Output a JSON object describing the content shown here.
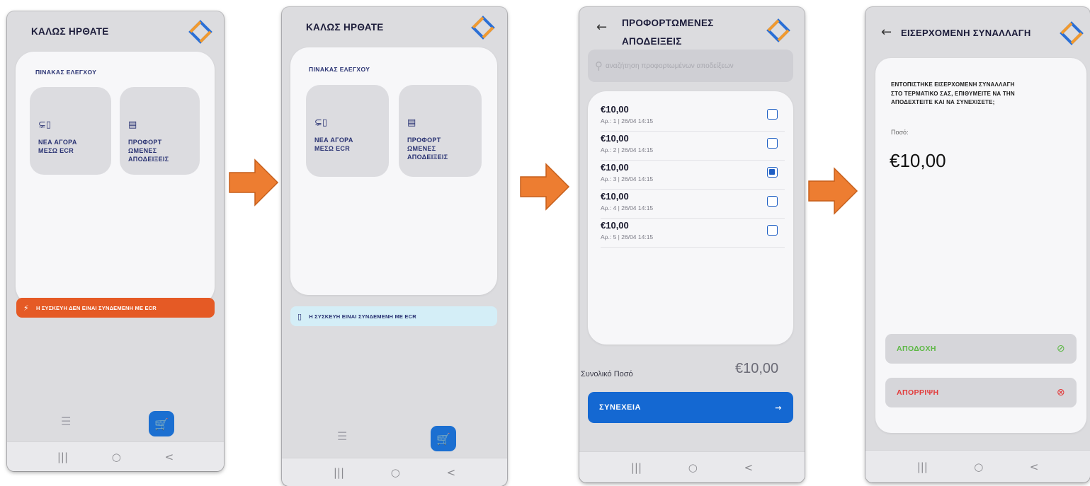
{
  "colors": {
    "navy": "#2a3373",
    "disconnected_bg": "#e55a25",
    "connected_bg": "#d4eef7",
    "primary": "#1468d2",
    "accept": "#5db845",
    "reject": "#e23b3b",
    "arrow": "#ed7d31"
  },
  "screen1": {
    "title": "ΚΑΛΩΣ ΗΡΘΑΤΕ",
    "dashboard_title": "ΠΙΝΑΚΑΣ ΕΛΕΓΧΟΥ",
    "tile1": {
      "icon": "ecr-device-icon",
      "glyph": "⊊▯",
      "label_l1": "ΝΕΑ ΑΓΟΡΑ",
      "label_l2": "ΜΕΣΩ ECR"
    },
    "tile2": {
      "icon": "receipt-icon",
      "glyph": "▤",
      "label_l1": "ΠΡΟΦΟΡΤ",
      "label_l2": "ΩΜΕΝΕΣ",
      "label_l3": "ΑΠΟΔΕΙΞΕΙΣ"
    },
    "status": {
      "icon": "disconnected-icon",
      "glyph": "⚡",
      "text": "Η ΣΥΣΚΕΥΗ ΔΕΝ ΕΙΝΑΙ ΣΥΝΔΕΜΕΝΗ ΜΕ ECR"
    },
    "list_glyph": "☰",
    "cart_glyph": "🛒"
  },
  "screen2": {
    "title": "ΚΑΛΩΣ ΗΡΘΑΤΕ",
    "dashboard_title": "ΠΙΝΑΚΑΣ ΕΛΕΓΧΟΥ",
    "tile1": {
      "glyph": "⊊▯",
      "label_l1": "ΝΕΑ ΑΓΟΡΑ",
      "label_l2": "ΜΕΣΩ ECR"
    },
    "tile2": {
      "glyph": "▤",
      "label_l1": "ΠΡΟΦΟΡΤ",
      "label_l2": "ΩΜΕΝΕΣ",
      "label_l3": "ΑΠΟΔΕΙΞΕΙΣ"
    },
    "status": {
      "icon": "connected-icon",
      "glyph": "▯",
      "text": "Η ΣΥΣΚΕΥΗ ΕΙΝΑΙ ΣΥΝΔΕΜΕΝΗ ΜΕ ECR"
    },
    "list_glyph": "☰",
    "cart_glyph": "🛒"
  },
  "screen3": {
    "back_glyph": "←",
    "title_l1": "ΠΡΟΦΟΡΤΩΜΕΝΕΣ",
    "title_l2": "ΑΠΟΔΕΙΞΕΙΣ",
    "search_placeholder": "αναζήτηση προφορτωμένων αποδείξεων",
    "search_glyph": "⚲",
    "receipts": [
      {
        "amount": "€10,00",
        "meta": "Αρ.: 1 | 26/04 14:15",
        "checked": false
      },
      {
        "amount": "€10,00",
        "meta": "Αρ.: 2 | 26/04 14:15",
        "checked": false
      },
      {
        "amount": "€10,00",
        "meta": "Αρ.: 3 | 26/04 14:15",
        "checked": true
      },
      {
        "amount": "€10,00",
        "meta": "Αρ.: 4 | 26/04 14:15",
        "checked": false
      },
      {
        "amount": "€10,00",
        "meta": "Αρ.: 5 | 26/04 14:15",
        "checked": false
      }
    ],
    "total_label": "Συνολικό Ποσό",
    "total_value": "€10,00",
    "continue_label": "ΣΥΝΕΧΕΙΑ",
    "continue_arrow": "→"
  },
  "screen4": {
    "back_glyph": "←",
    "title": "ΕΙΣΕΡΧΟΜΕΝΗ ΣΥΝΑΛΛΑΓΗ",
    "message_l1": "ΕΝΤΟΠΙΣΤΗΚΕ ΕΙΣΕΡΧΟΜΕΝΗ ΣΥΝΑΛΛΑΓΗ",
    "message_l2": "ΣΤΟ ΤΕΡΜΑΤΙΚΟ ΣΑΣ, ΕΠΙΘΥΜΕΙΤΕ ΝΑ ΤΗΝ",
    "message_l3": "ΑΠΟΔΕΧΤΕΙΤΕ ΚΑΙ ΝΑ ΣΥΝΕΧΙΣΕΤΕ;",
    "amount_label": "Ποσό:",
    "amount": "€10,00",
    "accept_label": "ΑΠΟΔΟΧΗ",
    "accept_glyph": "⊘",
    "reject_label": "ΑΠΟΡΡΙΨΗ",
    "reject_glyph": "⊗"
  },
  "navbar": {
    "recent": "|||",
    "home": "○",
    "back": "<"
  }
}
